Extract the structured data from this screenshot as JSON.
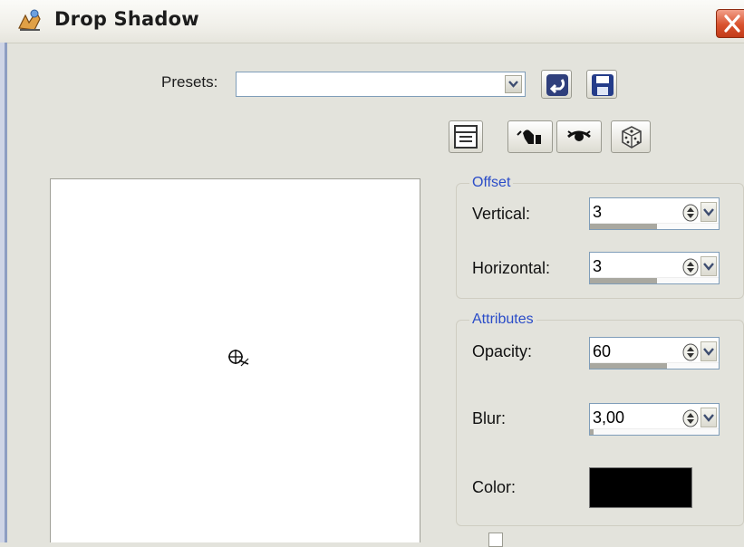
{
  "window": {
    "title": "Drop Shadow"
  },
  "presets": {
    "label": "Presets:",
    "value": ""
  },
  "offset": {
    "legend": "Offset",
    "vertical": {
      "label": "Vertical:",
      "value": "3"
    },
    "horizontal": {
      "label": "Horizontal:",
      "value": "3"
    }
  },
  "attributes": {
    "legend": "Attributes",
    "opacity": {
      "label": "Opacity:",
      "value": "60",
      "level": 0.6
    },
    "blur": {
      "label": "Blur:",
      "value": "3,00"
    },
    "color": {
      "label": "Color:",
      "value": "#000000"
    }
  },
  "icons": {
    "app": "drop-shadow-app-icon",
    "close": "close-icon",
    "reset": "reset-icon",
    "save": "save-icon",
    "toolbar": [
      "layout-icon",
      "pan-hand-icon",
      "eye-preview-icon",
      "randomize-dice-icon"
    ]
  },
  "colors": {
    "legend": "#2a4cc8",
    "shadow": "#000000"
  }
}
